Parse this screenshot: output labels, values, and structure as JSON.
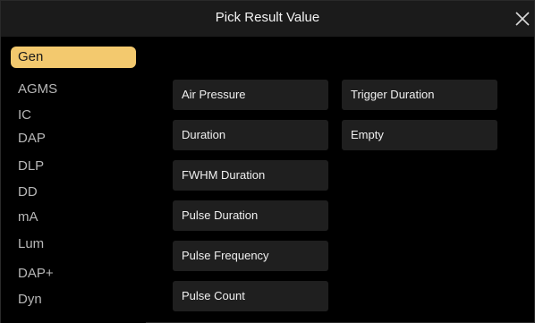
{
  "dialog": {
    "title": "Pick Result Value",
    "close_icon": "close-icon"
  },
  "sidebar": {
    "items": [
      {
        "label": "Gen",
        "active": true
      },
      {
        "label": "AGMS",
        "active": false
      },
      {
        "label": "IC",
        "active": false
      },
      {
        "label": "DAP",
        "active": false
      },
      {
        "label": "DLP",
        "active": false
      },
      {
        "label": "DD",
        "active": false
      },
      {
        "label": "mA",
        "active": false
      },
      {
        "label": "Lum",
        "active": false
      },
      {
        "label": "DAP+",
        "active": false
      },
      {
        "label": "Dyn",
        "active": false
      }
    ]
  },
  "values": {
    "column1": [
      {
        "label": "Air Pressure"
      },
      {
        "label": "Duration"
      },
      {
        "label": "FWHM Duration"
      },
      {
        "label": "Pulse Duration"
      },
      {
        "label": "Pulse Frequency"
      },
      {
        "label": "Pulse Count"
      }
    ],
    "column2": [
      {
        "label": "Trigger Duration"
      },
      {
        "label": "Empty"
      }
    ]
  },
  "colors": {
    "accent": "#f3c96e",
    "background": "#000000",
    "title_bar": "#1b1b1b",
    "tile": "#1f1f1f"
  }
}
